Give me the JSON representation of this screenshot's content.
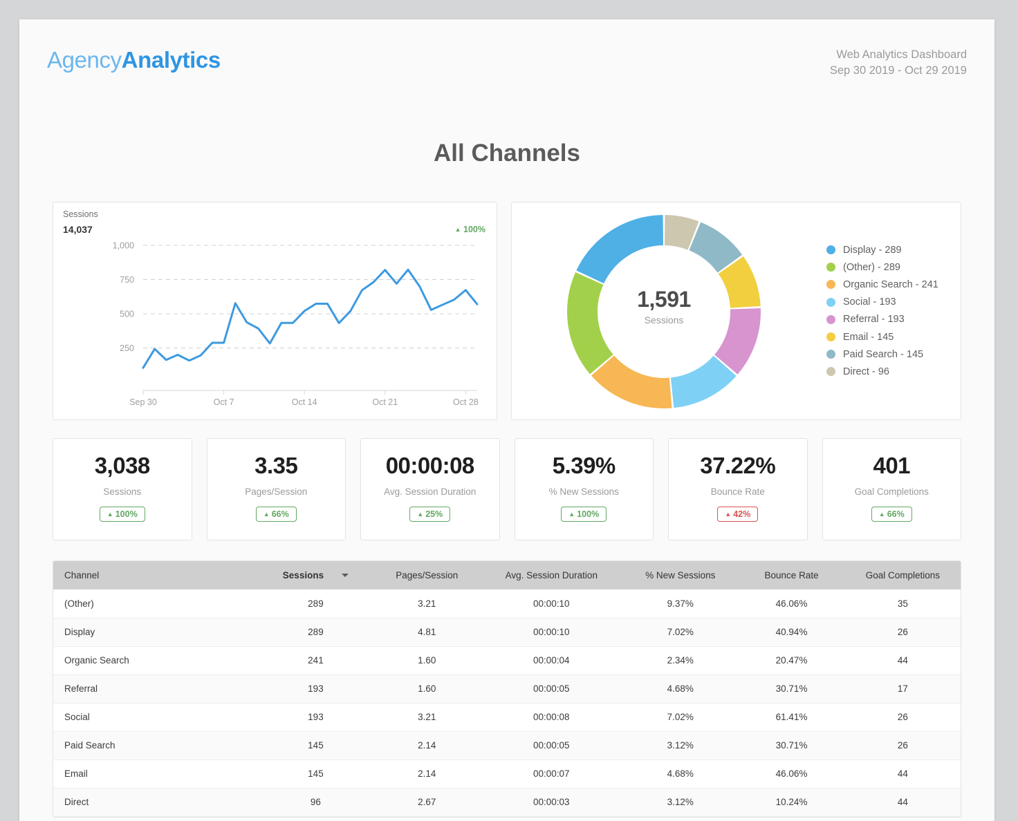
{
  "header": {
    "logo_light": "Agency",
    "logo_bold": "Analytics",
    "report_title": "Web Analytics Dashboard",
    "date_range": "Sep 30 2019 - Oct 29 2019"
  },
  "page_title": "All Channels",
  "line_card": {
    "metric_label": "Sessions",
    "metric_value": "14,037",
    "trend": "100%",
    "trend_arrow": "▲"
  },
  "donut_card": {
    "center_value": "1,591",
    "center_label": "Sessions"
  },
  "kpis": [
    {
      "value": "3,038",
      "label": "Sessions",
      "badge": "100%",
      "arrow": "▲",
      "direction": "up",
      "tone": "positive"
    },
    {
      "value": "3.35",
      "label": "Pages/Session",
      "badge": "66%",
      "arrow": "▲",
      "direction": "up",
      "tone": "positive"
    },
    {
      "value": "00:00:08",
      "label": "Avg. Session Duration",
      "badge": "25%",
      "arrow": "▲",
      "direction": "up",
      "tone": "positive"
    },
    {
      "value": "5.39%",
      "label": "% New Sessions",
      "badge": "100%",
      "arrow": "▲",
      "direction": "up",
      "tone": "positive"
    },
    {
      "value": "37.22%",
      "label": "Bounce Rate",
      "badge": "42%",
      "arrow": "▲",
      "direction": "up",
      "tone": "negative"
    },
    {
      "value": "401",
      "label": "Goal Completions",
      "badge": "66%",
      "arrow": "▲",
      "direction": "up",
      "tone": "positive"
    }
  ],
  "table": {
    "columns": [
      "Channel",
      "Sessions",
      "Pages/Session",
      "Avg. Session Duration",
      "% New Sessions",
      "Bounce Rate",
      "Goal Completions"
    ],
    "sorted_column": "Sessions",
    "sort_direction": "desc",
    "rows": [
      {
        "channel": "(Other)",
        "sessions": "289",
        "pages_session": "3.21",
        "avg_duration": "00:00:10",
        "new_sessions": "9.37%",
        "bounce_rate": "46.06%",
        "goal_completions": "35"
      },
      {
        "channel": "Display",
        "sessions": "289",
        "pages_session": "4.81",
        "avg_duration": "00:00:10",
        "new_sessions": "7.02%",
        "bounce_rate": "40.94%",
        "goal_completions": "26"
      },
      {
        "channel": "Organic Search",
        "sessions": "241",
        "pages_session": "1.60",
        "avg_duration": "00:00:04",
        "new_sessions": "2.34%",
        "bounce_rate": "20.47%",
        "goal_completions": "44"
      },
      {
        "channel": "Referral",
        "sessions": "193",
        "pages_session": "1.60",
        "avg_duration": "00:00:05",
        "new_sessions": "4.68%",
        "bounce_rate": "30.71%",
        "goal_completions": "17"
      },
      {
        "channel": "Social",
        "sessions": "193",
        "pages_session": "3.21",
        "avg_duration": "00:00:08",
        "new_sessions": "7.02%",
        "bounce_rate": "61.41%",
        "goal_completions": "26"
      },
      {
        "channel": "Paid Search",
        "sessions": "145",
        "pages_session": "2.14",
        "avg_duration": "00:00:05",
        "new_sessions": "3.12%",
        "bounce_rate": "30.71%",
        "goal_completions": "26"
      },
      {
        "channel": "Email",
        "sessions": "145",
        "pages_session": "2.14",
        "avg_duration": "00:00:07",
        "new_sessions": "4.68%",
        "bounce_rate": "46.06%",
        "goal_completions": "44"
      },
      {
        "channel": "Direct",
        "sessions": "96",
        "pages_session": "2.67",
        "avg_duration": "00:00:03",
        "new_sessions": "3.12%",
        "bounce_rate": "10.24%",
        "goal_completions": "44"
      }
    ]
  },
  "chart_data": [
    {
      "type": "line",
      "title": "Sessions",
      "total": 14037,
      "xlabel": "",
      "ylabel": "",
      "ylim": [
        0,
        1000
      ],
      "yticks": [
        250,
        500,
        750,
        1000
      ],
      "ytick_labels": [
        "250",
        "500",
        "750",
        "1,000"
      ],
      "grid": true,
      "legend": "none",
      "line_color": "#3d9ae0",
      "xtick_labels": [
        "Sep 30",
        "Oct 7",
        "Oct 14",
        "Oct 21",
        "Oct 28"
      ],
      "xtick_indices": [
        0,
        7,
        14,
        21,
        28
      ],
      "x": [
        "Sep 30",
        "Oct 1",
        "Oct 2",
        "Oct 3",
        "Oct 4",
        "Oct 5",
        "Oct 6",
        "Oct 7",
        "Oct 8",
        "Oct 9",
        "Oct 10",
        "Oct 11",
        "Oct 12",
        "Oct 13",
        "Oct 14",
        "Oct 15",
        "Oct 16",
        "Oct 17",
        "Oct 18",
        "Oct 19",
        "Oct 20",
        "Oct 21",
        "Oct 22",
        "Oct 23",
        "Oct 24",
        "Oct 25",
        "Oct 26",
        "Oct 27",
        "Oct 28",
        "Oct 29"
      ],
      "values": [
        105,
        243,
        163,
        200,
        158,
        196,
        288,
        288,
        577,
        437,
        392,
        283,
        433,
        433,
        520,
        573,
        573,
        432,
        520,
        672,
        731,
        820,
        720,
        822,
        700,
        528,
        566,
        603,
        673,
        570
      ]
    },
    {
      "type": "pie",
      "variant": "donut",
      "title": "Sessions by Channel",
      "center_value": 1591,
      "center_label": "Sessions",
      "legend": "right",
      "start_angle_deg": 0,
      "direction": "clockwise",
      "labels": [
        "Display",
        "(Other)",
        "Organic Search",
        "Social",
        "Referral",
        "Email",
        "Paid Search",
        "Direct"
      ],
      "values": [
        289,
        289,
        241,
        193,
        193,
        145,
        145,
        96
      ],
      "colors": [
        "#4fb0e5",
        "#a2d04a",
        "#f5b köz",
        "#7fd0f5",
        "#d794cf",
        "#f2cf3f",
        "#8fb9c6",
        "#ccc7ae"
      ],
      "segment_order_clockwise_from_top": [
        "Direct",
        "Paid Search",
        "Email",
        "Referral",
        "Social",
        "Organic Search",
        "(Other)",
        "Display"
      ],
      "legend_entries": [
        {
          "label": "Display - 289",
          "color": "#4fb0e5"
        },
        {
          "label": "(Other) - 289",
          "color": "#a2d04a"
        },
        {
          "label": "Organic Search - 241",
          "color": "#f7b755"
        },
        {
          "label": "Social - 193",
          "color": "#7fd0f5"
        },
        {
          "label": "Referral - 193",
          "color": "#d794cf"
        },
        {
          "label": "Email - 145",
          "color": "#f2cf3f"
        },
        {
          "label": "Paid Search - 145",
          "color": "#8fb9c6"
        },
        {
          "label": "Direct - 96",
          "color": "#ccc7ae"
        }
      ]
    }
  ]
}
